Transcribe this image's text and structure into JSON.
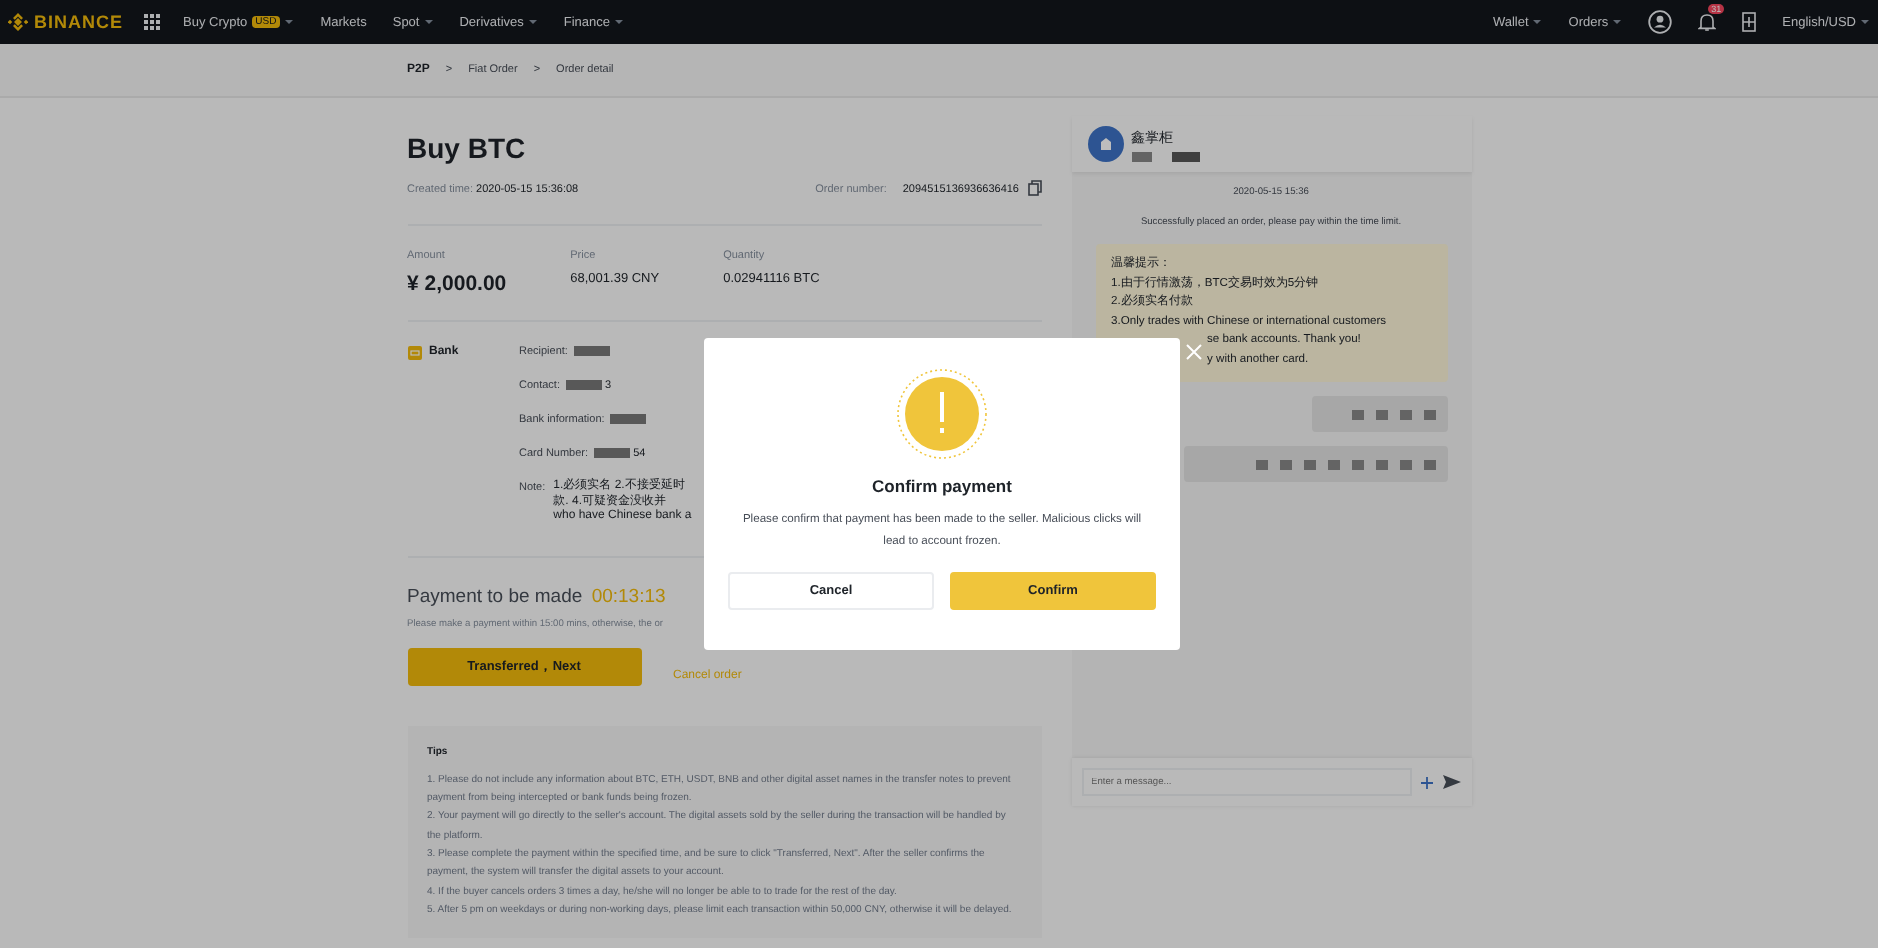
{
  "nav": {
    "logo": "BINANCE",
    "items": [
      {
        "label": "Buy Crypto",
        "badge": "USD",
        "dropdown": true
      },
      {
        "label": "Markets",
        "dropdown": false
      },
      {
        "label": "Spot",
        "dropdown": true
      },
      {
        "label": "Derivatives",
        "dropdown": true
      },
      {
        "label": "Finance",
        "dropdown": true
      }
    ],
    "right_items": [
      {
        "label": "Wallet",
        "dropdown": true
      },
      {
        "label": "Orders",
        "dropdown": true
      }
    ],
    "notification_count": "31",
    "language": "English/USD"
  },
  "breadcrumb": {
    "separator": ">",
    "items": [
      "P2P",
      "Fiat Order",
      "Order detail"
    ]
  },
  "order": {
    "title": "Buy BTC",
    "created_label": "Created time:",
    "created_time": "2020-05-15 15:36:08",
    "order_number_label": "Order number:",
    "order_number": "2094515136936636416",
    "summary": [
      {
        "label": "Amount",
        "value": "¥ 2,000.00",
        "kind": "large"
      },
      {
        "label": "Price",
        "value": "68,001.39 CNY",
        "kind": "normal"
      },
      {
        "label": "Quantity",
        "value": "0.02941116 BTC",
        "kind": "normal"
      }
    ],
    "payment_method": "Bank",
    "fields": [
      {
        "label": "Recipient:"
      },
      {
        "label": "Contact:",
        "value": "3"
      },
      {
        "label": "Bank information:"
      },
      {
        "label": "Card Number:",
        "value": "54"
      }
    ],
    "note_label": "Note:",
    "note_lines": [
      "1.必须实名 2.不接受延时",
      "款. 4.可疑资金没收并",
      "who have Chinese bank a"
    ],
    "payment_due_label": "Payment to be made",
    "timer": "00:13:13",
    "payment_hint": "Please make a payment within 15:00 mins, otherwise, the or",
    "primary_button": "Transferred，Next",
    "cancel_link": "Cancel order",
    "tips": {
      "title": "Tips",
      "items": [
        "1. Please do not include any information about BTC, ETH, USDT, BNB and other digital asset names in the transfer notes to prevent payment from being intercepted or bank funds being frozen.",
        "2. Your payment will go directly to the seller's account. The digital assets sold by the seller during the transaction will be handled by the platform.",
        "3. Please complete the payment within the specified time, and be sure to click \"Transferred, Next\". After the seller confirms the payment, the system will transfer the digital assets to your account.",
        "4. If the buyer cancels orders 3 times a day, he/she will no longer be able to to trade for the rest of the day.",
        "5. After 5 pm on weekdays or during non-working days, please limit each transaction within 50,000 CNY, otherwise it will be delayed."
      ]
    }
  },
  "chat": {
    "name": "鑫掌柜",
    "timestamp": "2020-05-15 15:36",
    "system_message": "Successfully placed an order, please pay within the time limit.",
    "bubble_lines": [
      {
        "text": "温馨提示：",
        "kind": "full"
      },
      {
        "text": "1.由于行情激荡，BTC交易时效为5分钟",
        "kind": "full"
      },
      {
        "text": "2.必须实名付款",
        "kind": "full"
      },
      {
        "text": "3.Only trades with Chinese or international customers",
        "kind": "full"
      },
      {
        "text": "se bank accounts. Thank you!",
        "kind": "cut"
      },
      {
        "text": "y with another card.",
        "kind": "cut"
      }
    ],
    "input_placeholder": "Enter a message..."
  },
  "modal": {
    "title": "Confirm payment",
    "message": "Please confirm that payment has been made to the seller. Malicious clicks will lead to account frozen.",
    "cancel_button": "Cancel",
    "confirm_button": "Confirm"
  }
}
